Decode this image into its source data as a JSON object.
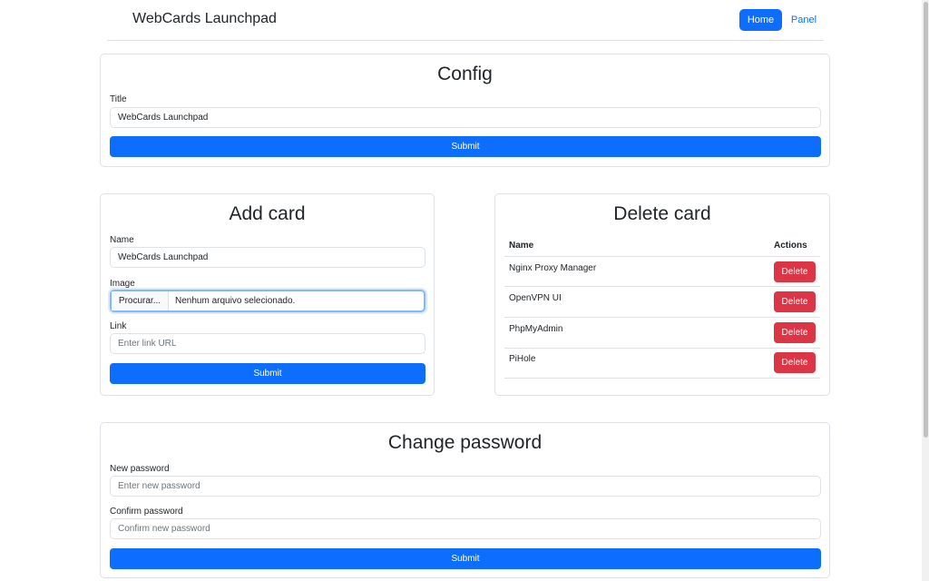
{
  "navbar": {
    "brand": "WebCards Launchpad",
    "home": "Home",
    "panel": "Panel"
  },
  "config": {
    "title": "Config",
    "title_label": "Title",
    "title_value": "WebCards Launchpad",
    "submit": "Submit"
  },
  "add_card": {
    "title": "Add card",
    "name_label": "Name",
    "name_value": "WebCards Launchpad",
    "image_label": "Image",
    "file_button": "Procurar...",
    "file_status": "Nenhum arquivo selecionado.",
    "link_label": "Link",
    "link_placeholder": "Enter link URL",
    "submit": "Submit"
  },
  "delete_card": {
    "title": "Delete card",
    "col_name": "Name",
    "col_actions": "Actions",
    "rows": [
      {
        "name": "Nginx Proxy Manager",
        "action": "Delete"
      },
      {
        "name": "OpenVPN UI",
        "action": "Delete"
      },
      {
        "name": "PhpMyAdmin",
        "action": "Delete"
      },
      {
        "name": "PiHole",
        "action": "Delete"
      }
    ]
  },
  "change_password": {
    "title": "Change password",
    "new_label": "New password",
    "new_placeholder": "Enter new password",
    "confirm_label": "Confirm password",
    "confirm_placeholder": "Confirm new password",
    "submit": "Submit"
  },
  "colors": {
    "primary": "#0d6efd",
    "danger": "#dc3545",
    "border": "#dee2e6",
    "focus": "#86b7fe"
  }
}
